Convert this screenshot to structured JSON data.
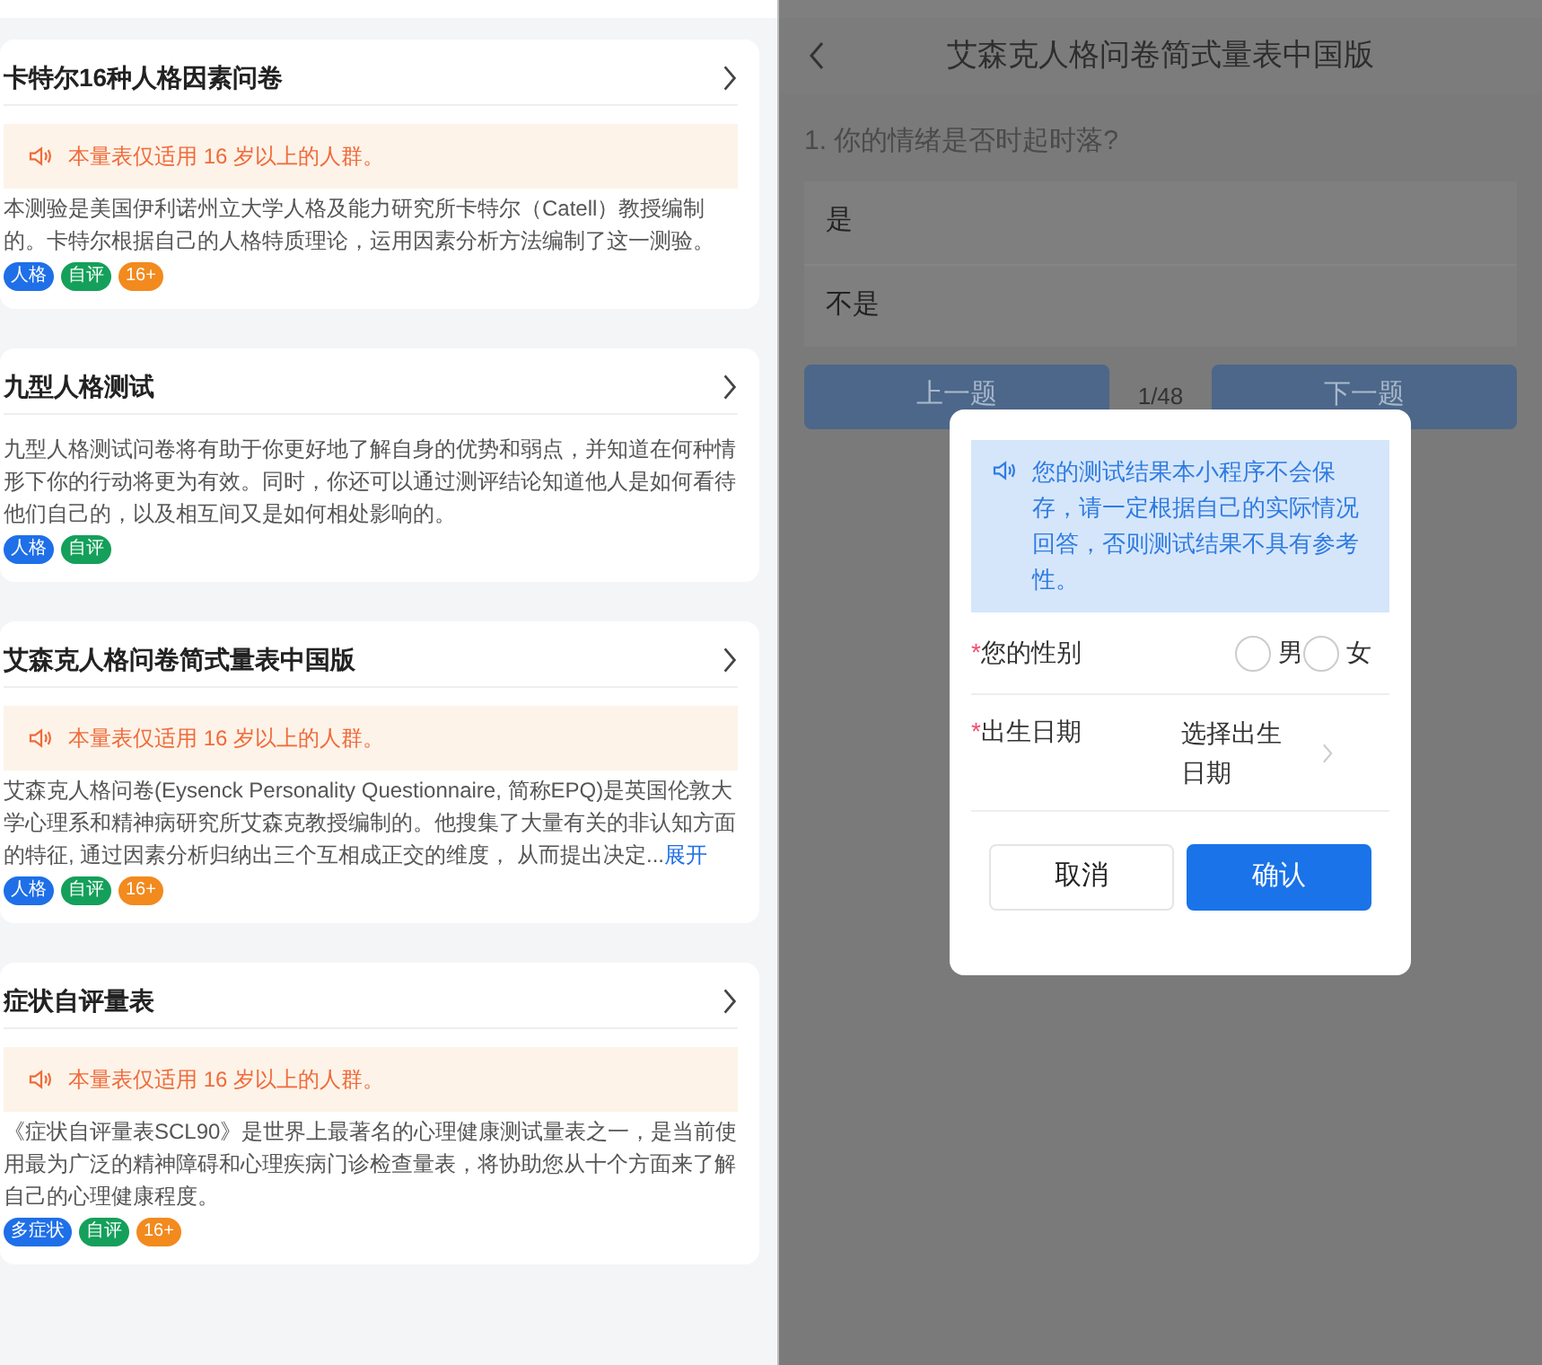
{
  "cards": [
    {
      "title": "卡特尔16种人格因素问卷",
      "notice": "本量表仅适用 16 岁以上的人群。",
      "description": "本测验是美国伊利诺州立大学人格及能力研究所卡特尔（Catell）教授编制的。卡特尔根据自己的人格特质理论，运用因素分析方法编制了这一测验。",
      "tags": [
        {
          "label": "人格",
          "color": "#1e6fe8"
        },
        {
          "label": "自评",
          "color": "#14a05a"
        },
        {
          "label": "16+",
          "color": "#f28a1e"
        }
      ]
    },
    {
      "title": "九型人格测试",
      "description": "九型人格测试问卷将有助于你更好地了解自身的优势和弱点，并知道在何种情形下你的行动将更为有效。同时，你还可以通过测评结论知道他人是如何看待他们自己的，以及相互间又是如何相处影响的。",
      "tags": [
        {
          "label": "人格",
          "color": "#1e6fe8"
        },
        {
          "label": "自评",
          "color": "#14a05a"
        }
      ]
    },
    {
      "title": "艾森克人格问卷简式量表中国版",
      "notice": "本量表仅适用 16 岁以上的人群。",
      "description": "艾森克人格问卷(Eysenck Personality Questionnaire, 简称EPQ)是英国伦敦大学心理系和精神病研究所艾森克教授编制的。他搜集了大量有关的非认知方面的特征, 通过因素分析归纳出三个互相成正交的维度， 从而提出决定...",
      "expand_link": "展开",
      "tags": [
        {
          "label": "人格",
          "color": "#1e6fe8"
        },
        {
          "label": "自评",
          "color": "#14a05a"
        },
        {
          "label": "16+",
          "color": "#f28a1e"
        }
      ]
    },
    {
      "title": "症状自评量表",
      "notice": "本量表仅适用 16 岁以上的人群。",
      "description": "《症状自评量表SCL90》是世界上最著名的心理健康测试量表之一，是当前使用最为广泛的精神障碍和心理疾病门诊检查量表，将协助您从十个方面来了解自己的心理健康程度。",
      "tags": [
        {
          "label": "多症状",
          "color": "#1e6fe8"
        },
        {
          "label": "自评",
          "color": "#14a05a"
        },
        {
          "label": "16+",
          "color": "#f28a1e"
        }
      ]
    }
  ],
  "quiz": {
    "title": "艾森克人格问卷简式量表中国版",
    "question": "1. 你的情绪是否时起时落?",
    "options": [
      {
        "label": "是"
      },
      {
        "label": "不是"
      }
    ],
    "prev_button": "上一题",
    "progress": "1/48",
    "next_button": "下一题"
  },
  "dialog": {
    "notice": "您的测试结果本小程序不会保存，请一定根据自己的实际情况回答，否则测试结果不具有参考性。",
    "fields": [
      {
        "kind": "radio",
        "label": "您的性别",
        "required_mark": "*",
        "options": [
          {
            "label": "男",
            "selected": false
          },
          {
            "label": "女",
            "selected": false
          }
        ]
      },
      {
        "kind": "picker",
        "label": "出生日期",
        "required_mark": "*",
        "value": "选择出生日期"
      }
    ],
    "cancel_button": "取消",
    "confirm_button": "确认"
  }
}
